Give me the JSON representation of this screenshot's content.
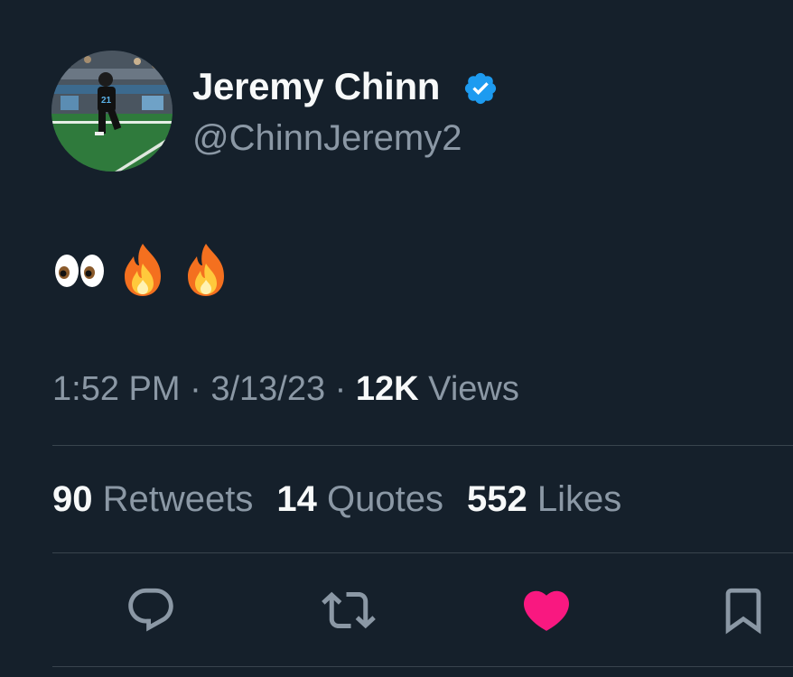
{
  "author": {
    "display_name": "Jeremy Chinn",
    "handle": "@ChinnJeremy2",
    "verified": true,
    "verified_color": "#1d9bf0",
    "avatar_icon": "football-player-avatar"
  },
  "tweet": {
    "emojis": [
      "eyes-emoji",
      "fire-emoji",
      "fire-emoji"
    ]
  },
  "meta": {
    "time": "1:52 PM",
    "separator": "·",
    "date": "3/13/23",
    "views_count": "12K",
    "views_label": "Views"
  },
  "stats": [
    {
      "count": "90",
      "label": "Retweets"
    },
    {
      "count": "14",
      "label": "Quotes"
    },
    {
      "count": "552",
      "label": "Likes"
    }
  ],
  "actions": {
    "reply_icon": "reply-icon",
    "retweet_icon": "retweet-icon",
    "like_icon": "heart-icon",
    "like_active": true,
    "like_color": "#f91880",
    "bookmark_icon": "bookmark-icon"
  },
  "colors": {
    "background": "#15202b",
    "primary_text": "#f7f9f9",
    "secondary_text": "#8b98a5",
    "divider": "#38444d"
  }
}
